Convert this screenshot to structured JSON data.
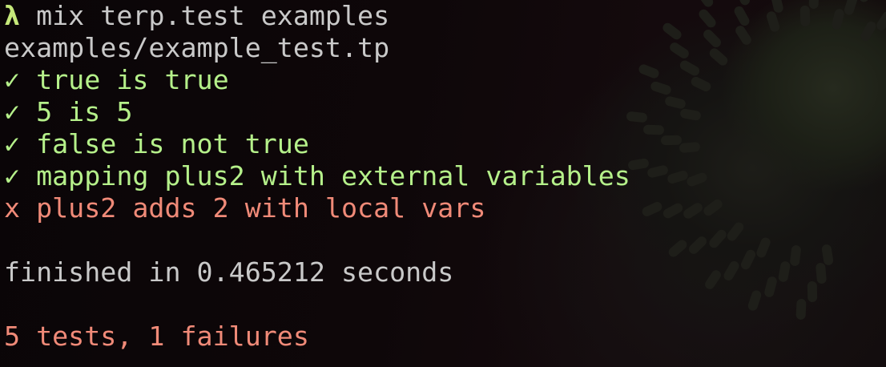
{
  "terminal": {
    "prompt_symbol": "λ",
    "command": " mix terp.test examples",
    "file": "examples/example_test.tp",
    "results": [
      {
        "status": "pass",
        "mark": "✓",
        "text": " true is true"
      },
      {
        "status": "pass",
        "mark": "✓",
        "text": " 5 is 5"
      },
      {
        "status": "pass",
        "mark": "✓",
        "text": " false is not true"
      },
      {
        "status": "pass",
        "mark": "✓",
        "text": " mapping plus2 with external variables"
      },
      {
        "status": "fail",
        "mark": "x",
        "text": " plus2 adds 2 with local vars"
      }
    ],
    "timing": "finished in 0.465212 seconds",
    "summary": "5 tests, 1 failures"
  },
  "colors": {
    "pass": "#b5f08a",
    "fail": "#f08a78",
    "text": "#c9c9c9",
    "background": "#0b0507"
  }
}
